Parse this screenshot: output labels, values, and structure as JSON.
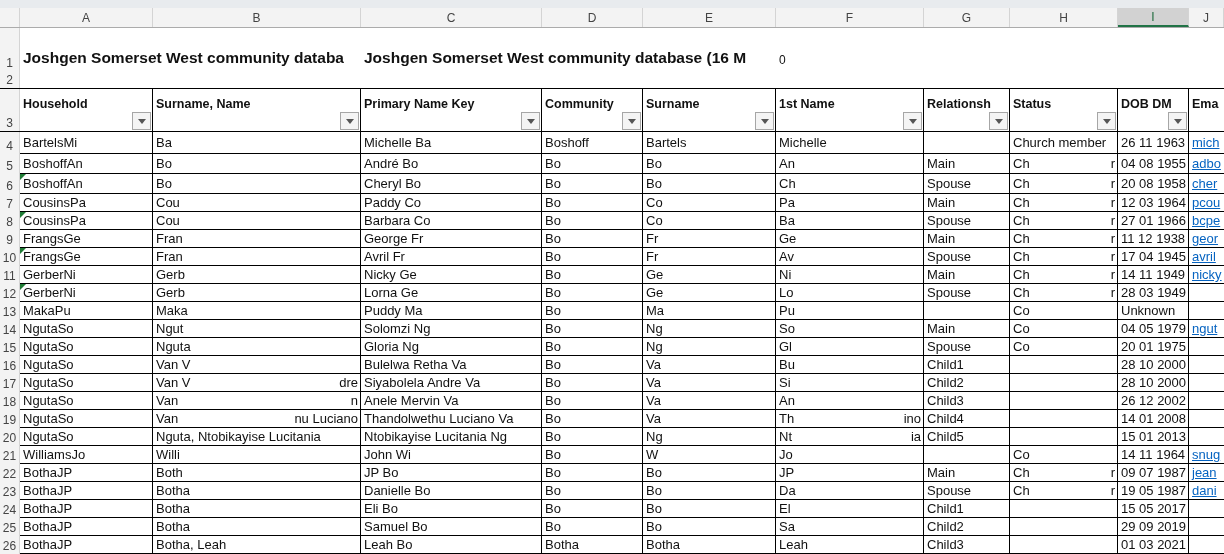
{
  "column_letters": [
    {
      "label": "A",
      "selected": false
    },
    {
      "label": "B",
      "selected": false
    },
    {
      "label": "C",
      "selected": false
    },
    {
      "label": "D",
      "selected": false
    },
    {
      "label": "E",
      "selected": false
    },
    {
      "label": "F",
      "selected": false
    },
    {
      "label": "G",
      "selected": false
    },
    {
      "label": "H",
      "selected": false
    },
    {
      "label": "I",
      "selected": true
    },
    {
      "label": "J",
      "selected": false
    }
  ],
  "title_row": {
    "number": "1",
    "cells": [
      "Joshgen Somerset West community databa",
      null,
      "Joshgen Somerset West community database (16  M",
      null,
      null,
      "0",
      null,
      null,
      null,
      null
    ]
  },
  "blank_row": {
    "number": "2"
  },
  "header_row": {
    "number": "3",
    "headers": [
      {
        "label": "Household",
        "filter": true
      },
      {
        "label": "Surname, Name",
        "filter": true
      },
      {
        "label": "Primary Name Key",
        "filter": true
      },
      {
        "label": "Community",
        "filter": true
      },
      {
        "label": "Surname",
        "filter": true
      },
      {
        "label": "1st Name",
        "filter": true
      },
      {
        "label": "Relationsh",
        "filter": true
      },
      {
        "label": "Status",
        "filter": true
      },
      {
        "label": "DOB DM",
        "filter": true
      },
      {
        "label": "Ema",
        "filter": false
      }
    ]
  },
  "rows": [
    {
      "number": "4",
      "flag": false,
      "cells": [
        "BartelsMi",
        "Ba",
        "Michelle Ba",
        "Boshoff",
        "Bartels",
        "Michelle",
        null,
        "Church member",
        "26 11 1963",
        {
          "kind": "link",
          "text": "mich"
        }
      ]
    },
    {
      "number": "5",
      "flag": false,
      "cells": [
        "BoshoffAn",
        "Bo",
        "André Bo",
        "Bo",
        "Bo",
        "An",
        "Main",
        {
          "kind": "split",
          "text": "Ch",
          "tail": "r"
        },
        "04 08 1955",
        {
          "kind": "link",
          "text": "adbo"
        }
      ]
    },
    {
      "number": "6",
      "flag": true,
      "cells": [
        "BoshoffAn",
        "Bo",
        "Cheryl Bo",
        "Bo",
        "Bo",
        "Ch",
        "Spouse",
        {
          "kind": "split",
          "text": "Ch",
          "tail": "r"
        },
        "20 08 1958",
        {
          "kind": "link",
          "text": "cher"
        }
      ]
    },
    {
      "number": "7",
      "flag": false,
      "cells": [
        "CousinsPa",
        "Cou",
        "Paddy Co",
        "Bo",
        "Co",
        "Pa",
        "Main",
        {
          "kind": "split",
          "text": "Ch",
          "tail": "r"
        },
        "12 03 1964",
        {
          "kind": "link",
          "text": "pcou"
        }
      ]
    },
    {
      "number": "8",
      "flag": true,
      "cells": [
        "CousinsPa",
        "Cou",
        "Barbara Co",
        "Bo",
        "Co",
        "Ba",
        "Spouse",
        {
          "kind": "split",
          "text": "Ch",
          "tail": "r"
        },
        "27 01 1966",
        {
          "kind": "link",
          "text": "bcpe"
        }
      ]
    },
    {
      "number": "9",
      "flag": false,
      "cells": [
        "FrangsGe",
        "Fran",
        "George Fr",
        "Bo",
        "Fr",
        "Ge",
        "Main",
        {
          "kind": "split",
          "text": "Ch",
          "tail": "r"
        },
        "11 12 1938",
        {
          "kind": "link",
          "text": "geor"
        }
      ]
    },
    {
      "number": "10",
      "flag": true,
      "cells": [
        "FrangsGe",
        "Fran",
        "Avril Fr",
        "Bo",
        "Fr",
        "Av",
        "Spouse",
        {
          "kind": "split",
          "text": "Ch",
          "tail": "r"
        },
        "17 04 1945",
        {
          "kind": "link",
          "text": "avril"
        }
      ]
    },
    {
      "number": "11",
      "flag": false,
      "cells": [
        "GerberNi",
        "Gerb",
        "Nicky Ge",
        "Bo",
        "Ge",
        "Ni",
        "Main",
        {
          "kind": "split",
          "text": "Ch",
          "tail": "r"
        },
        "14 11 1949",
        {
          "kind": "link",
          "text": "nicky"
        }
      ]
    },
    {
      "number": "12",
      "flag": true,
      "cells": [
        "GerberNi",
        "Gerb",
        "Lorna Ge",
        "Bo",
        "Ge",
        "Lo",
        "Spouse",
        {
          "kind": "split",
          "text": "Ch",
          "tail": "r"
        },
        "28 03 1949",
        null
      ]
    },
    {
      "number": "13",
      "flag": false,
      "cells": [
        "MakaPu",
        "Maka",
        "Puddy Ma",
        "Bo",
        "Ma",
        "Pu",
        null,
        "Co",
        "Unknown",
        null
      ]
    },
    {
      "number": "14",
      "flag": false,
      "cells": [
        "NgutaSo",
        "Ngut",
        "Solomzi Ng",
        "Bo",
        "Ng",
        "So",
        "Main",
        "Co",
        "04 05 1979",
        {
          "kind": "link",
          "text": "ngut"
        }
      ]
    },
    {
      "number": "15",
      "flag": false,
      "cells": [
        "NgutaSo",
        "Nguta",
        "Gloria Ng",
        "Bo",
        "Ng",
        "Gl",
        "Spouse",
        "Co",
        "20 01 1975",
        null
      ]
    },
    {
      "number": "16",
      "flag": false,
      "cells": [
        "NgutaSo",
        "Van V",
        "Bulelwa Retha Va",
        "Bo",
        "Va",
        "Bu",
        "Child1",
        null,
        "28 10 2000",
        null
      ]
    },
    {
      "number": "17",
      "flag": false,
      "cells": [
        "NgutaSo",
        {
          "kind": "split",
          "text": "Van V",
          "tail": "dre"
        },
        "Siyabolela Andre Va",
        "Bo",
        "Va",
        "Si",
        "Child2",
        null,
        "28 10 2000",
        null
      ]
    },
    {
      "number": "18",
      "flag": false,
      "cells": [
        "NgutaSo",
        {
          "kind": "split",
          "text": "Van",
          "tail": "n"
        },
        "Anele Mervin Va",
        "Bo",
        "Va",
        "An",
        "Child3",
        null,
        "26 12 2002",
        null
      ]
    },
    {
      "number": "19",
      "flag": false,
      "cells": [
        "NgutaSo",
        {
          "kind": "split",
          "text": "Van",
          "tail": "nu Luciano"
        },
        "Thandolwethu Luciano Va",
        "Bo",
        "Va",
        {
          "kind": "split",
          "text": "Th",
          "tail": "ino"
        },
        "Child4",
        null,
        "14 01 2008",
        null
      ]
    },
    {
      "number": "20",
      "flag": false,
      "cells": [
        "NgutaSo",
        "Nguta, Ntobikayise Lucitania",
        "Ntobikayise Lucitania Ng",
        "Bo",
        "Ng",
        {
          "kind": "split",
          "text": "Nt",
          "tail": "ia"
        },
        "Child5",
        null,
        "15 01 2013",
        null
      ]
    },
    {
      "number": "21",
      "flag": false,
      "cells": [
        "WilliamsJo",
        "Willi",
        "John Wi",
        "Bo",
        "W",
        "Jo",
        null,
        "Co",
        "14 11 1964",
        {
          "kind": "link",
          "text": "snug"
        }
      ]
    },
    {
      "number": "22",
      "flag": false,
      "cells": [
        "BothaJP",
        "Both",
        "JP Bo",
        "Bo",
        "Bo",
        "JP",
        "Main",
        {
          "kind": "split",
          "text": "Ch",
          "tail": "r"
        },
        "09 07 1987",
        {
          "kind": "link",
          "text": "jean"
        }
      ]
    },
    {
      "number": "23",
      "flag": false,
      "cells": [
        "BothaJP",
        "Botha",
        "Danielle Bo",
        "Bo",
        "Bo",
        "Da",
        "Spouse",
        {
          "kind": "split",
          "text": "Ch",
          "tail": "r"
        },
        "19 05 1987",
        {
          "kind": "link",
          "text": "dani"
        }
      ]
    },
    {
      "number": "24",
      "flag": false,
      "cells": [
        "BothaJP",
        "Botha",
        "Eli Bo",
        "Bo",
        "Bo",
        "El",
        "Child1",
        null,
        "15 05 2017",
        null
      ]
    },
    {
      "number": "25",
      "flag": false,
      "cells": [
        "BothaJP",
        "Botha",
        "Samuel Bo",
        "Bo",
        "Bo",
        "Sa",
        "Child2",
        null,
        "29 09 2019",
        null
      ]
    },
    {
      "number": "26",
      "flag": false,
      "cells": [
        "BothaJP",
        "Botha, Leah",
        "Leah Bo",
        "Botha",
        "Botha",
        "Leah",
        "Child3",
        null,
        "01 03 2021",
        null
      ]
    }
  ]
}
